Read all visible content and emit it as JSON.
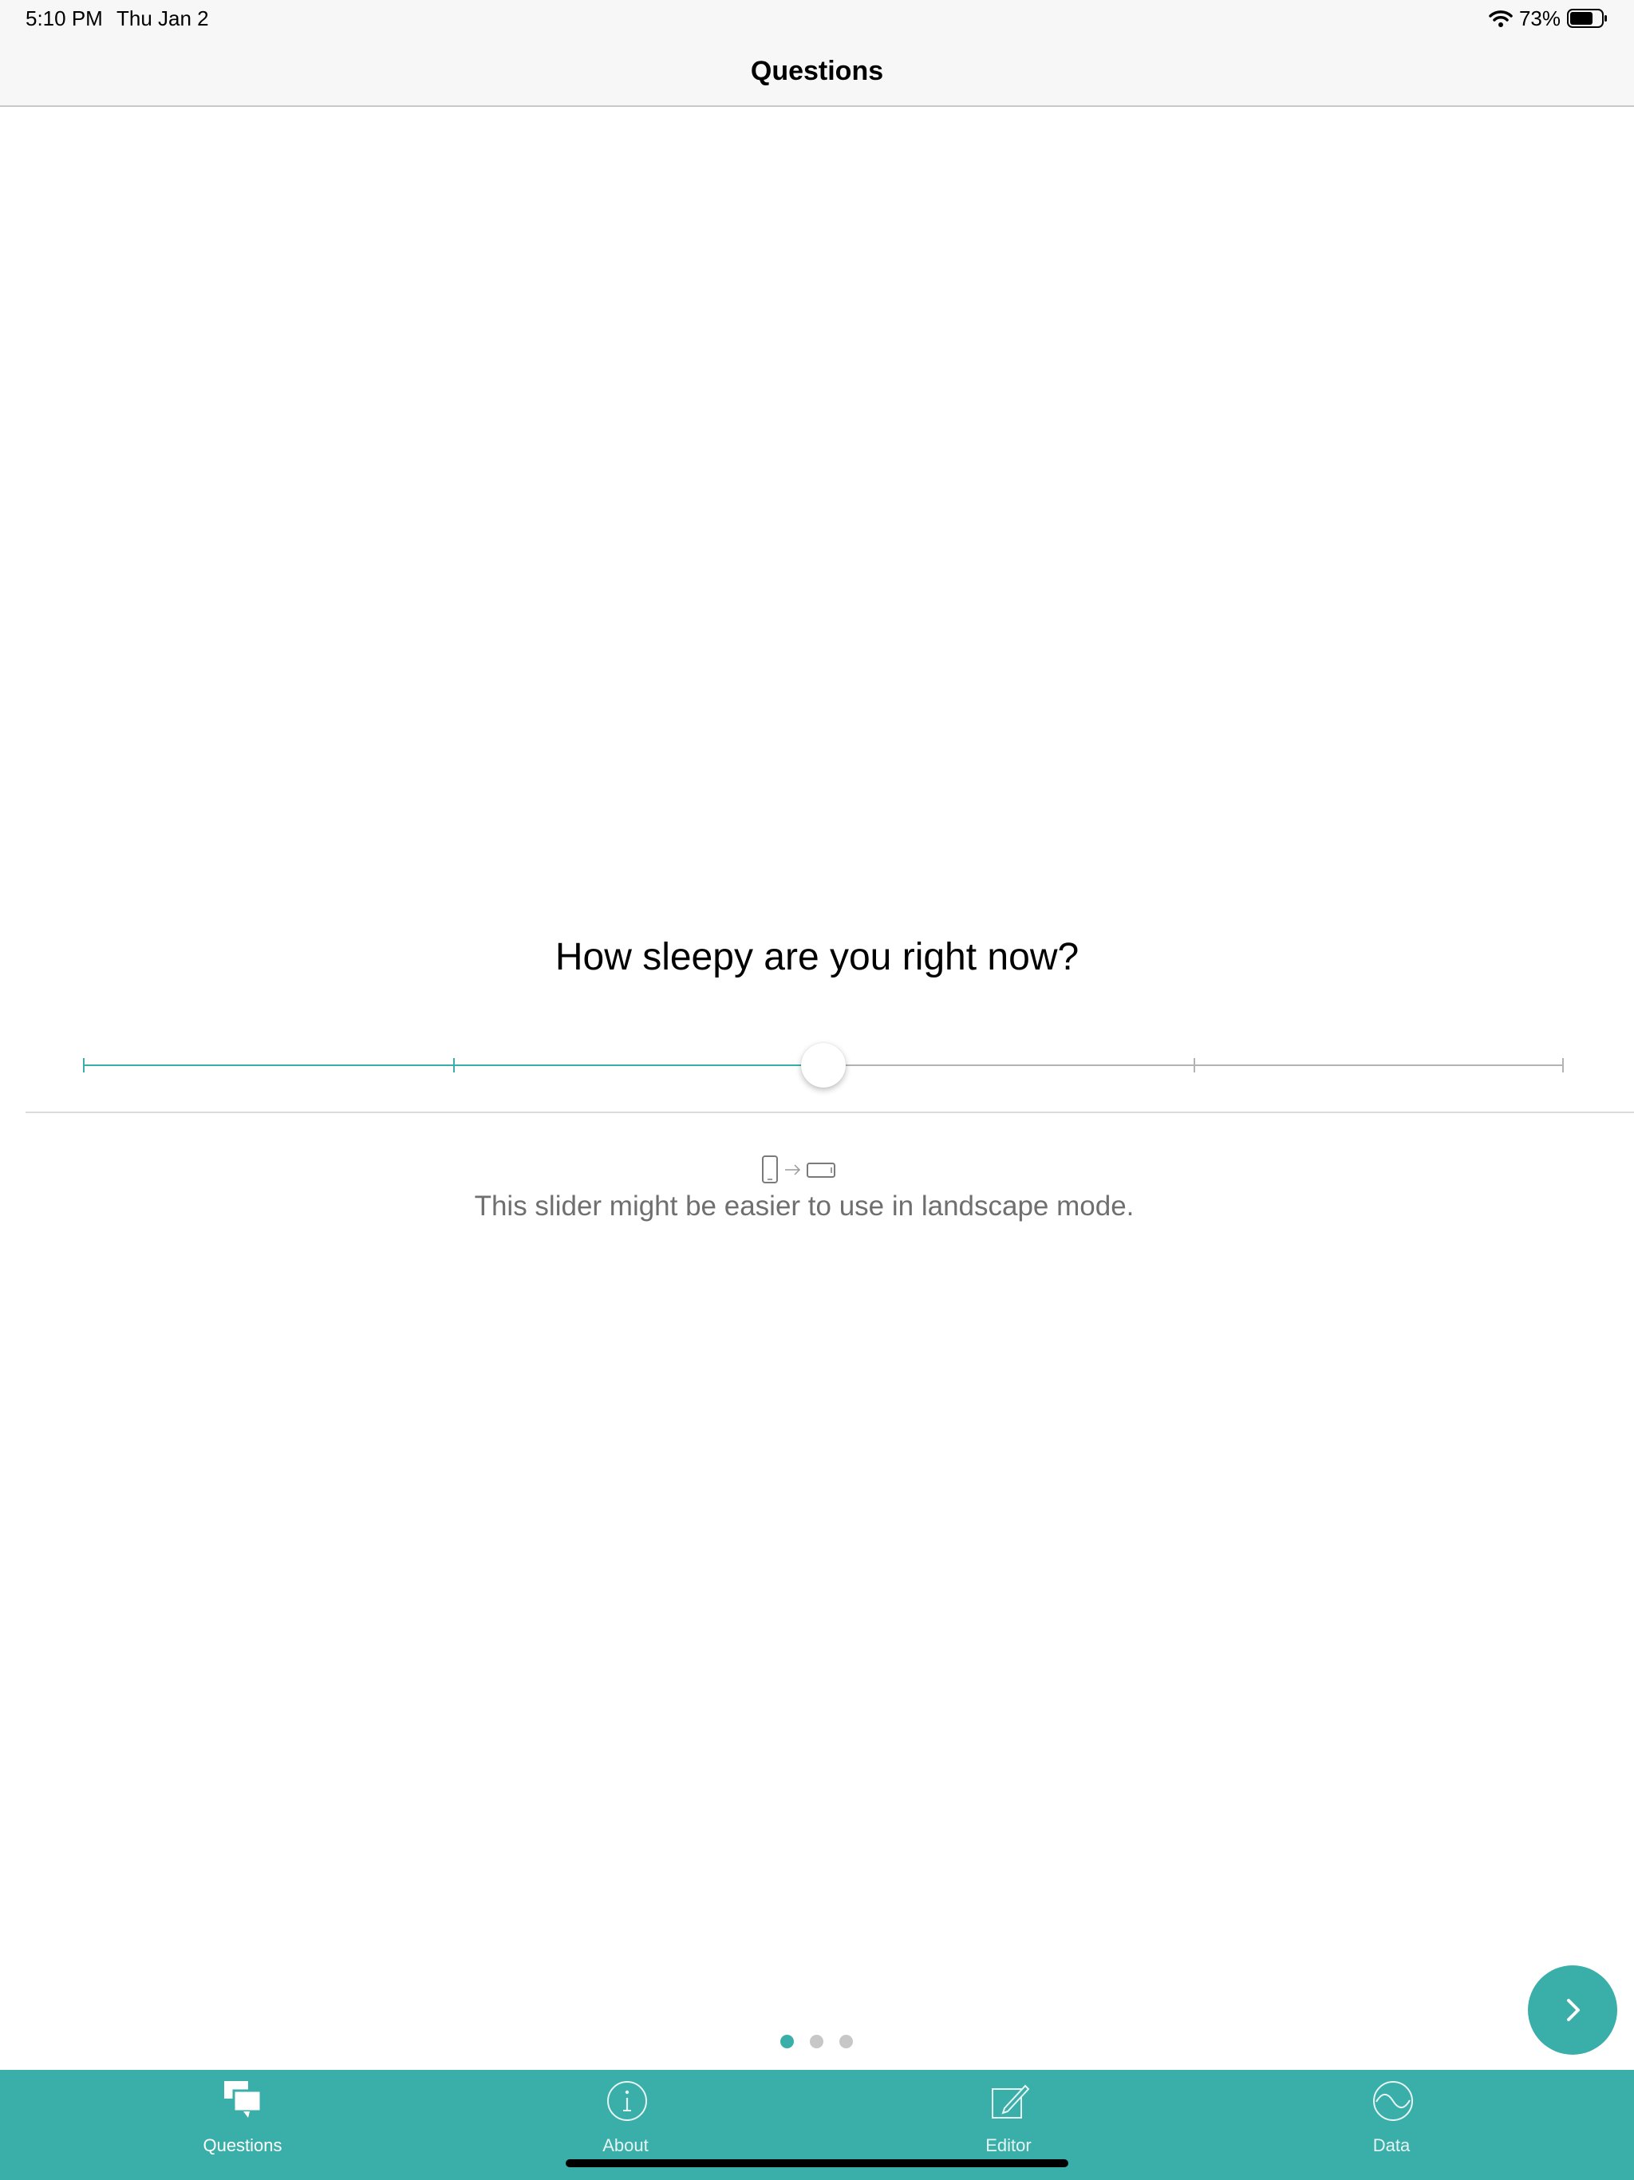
{
  "status_bar": {
    "time": "5:10 PM",
    "date": "Thu Jan 2",
    "battery_percent": "73%",
    "battery_level": 0.73,
    "icons": [
      "wifi-icon",
      "battery-icon"
    ]
  },
  "nav": {
    "title": "Questions"
  },
  "question": {
    "text": "How sleepy are you right now?"
  },
  "slider": {
    "value": 0.5,
    "tick_count": 5,
    "filled_color": "#3aafa9",
    "empty_color": "#b3b3b3"
  },
  "hint": {
    "icon": "rotate-to-landscape-icon",
    "text": "This slider might be easier to use in landscape mode."
  },
  "pagination": {
    "total": 3,
    "current": 1,
    "active_color": "#3aafa9",
    "inactive_color": "#c7c7c7"
  },
  "next_button": {
    "icon": "chevron-right-icon"
  },
  "tab_bar": {
    "background": "#3aafa9",
    "tabs": [
      {
        "label": "Questions",
        "icon": "chat-bubbles-icon",
        "active": true
      },
      {
        "label": "About",
        "icon": "info-icon",
        "active": false
      },
      {
        "label": "Editor",
        "icon": "edit-icon",
        "active": false
      },
      {
        "label": "Data",
        "icon": "wave-icon",
        "active": false
      }
    ]
  }
}
